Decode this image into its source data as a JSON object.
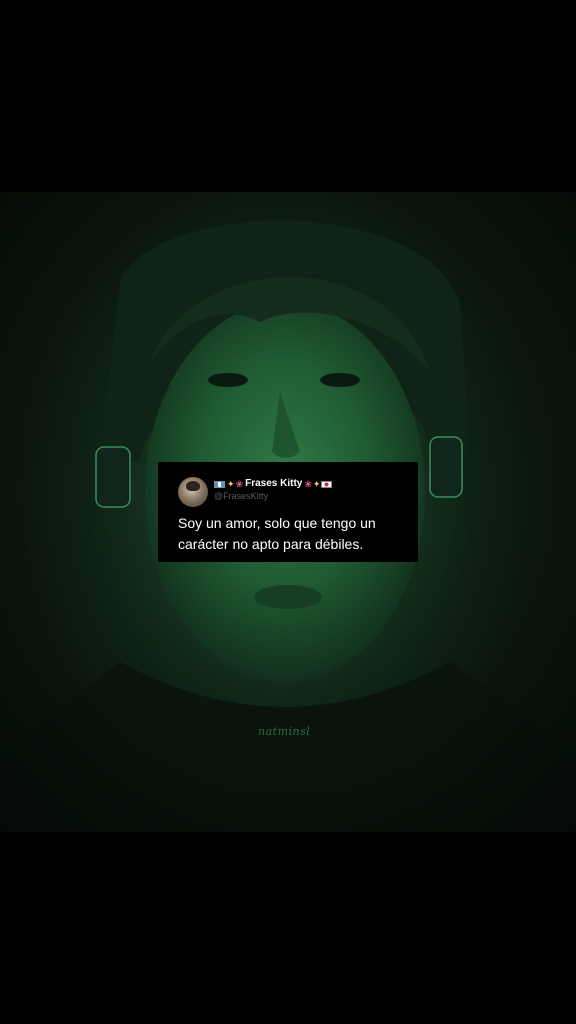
{
  "tweet": {
    "display_name": "Frases Kitty",
    "handle": "@FrasesKitty",
    "text_line1": "Soy un amor, solo que tengo un",
    "text_line2": "carácter no apto para débiles.",
    "emojis_left": [
      "flag-guatemala",
      "sparkles",
      "tulip"
    ],
    "emojis_right": [
      "tulip",
      "sparkles",
      "flag-south-korea"
    ]
  },
  "watermark": "natminsl",
  "colors": {
    "background": "#000000",
    "photo_tint": "#1f4a2c",
    "card_background": "#000000",
    "text": "#ffffff",
    "handle": "#5b5b5b"
  }
}
